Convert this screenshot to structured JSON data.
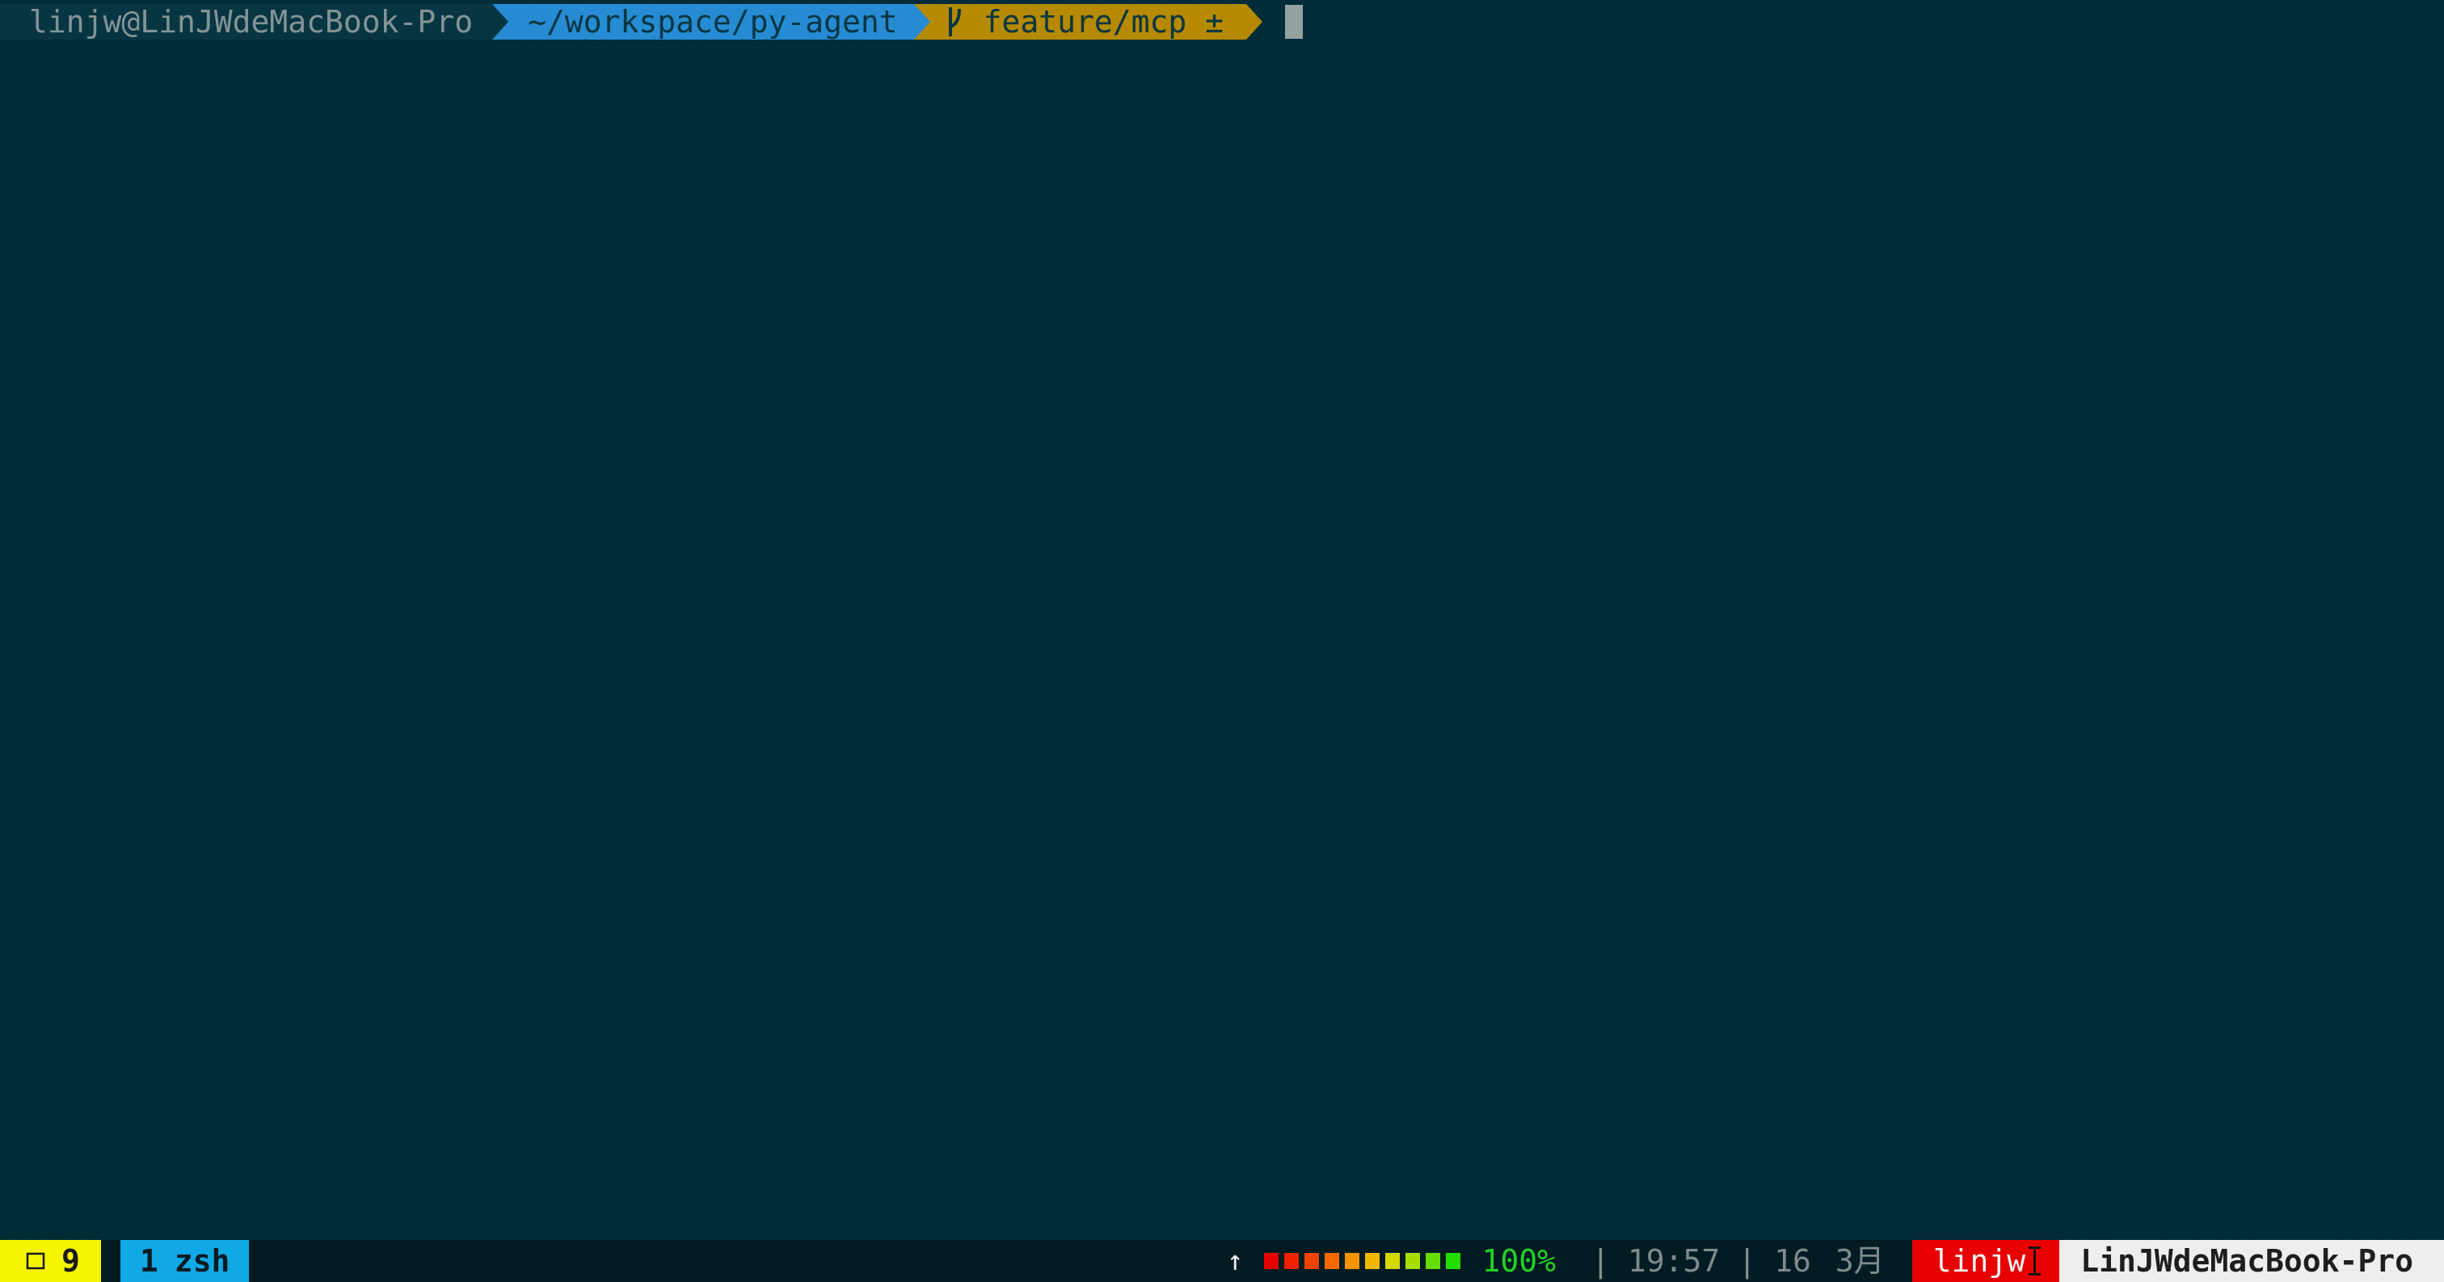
{
  "prompt": {
    "context": "linjw@LinJWdeMacBook-Pro",
    "directory": "~/workspace/py-agent",
    "branch_icon": "git-branch-icon",
    "branch": "feature/mcp ±"
  },
  "status_bar": {
    "session_icon": "window-icon",
    "session_count": "9",
    "window_index": "1",
    "window_name": "zsh",
    "upload_icon": "up-arrow-icon",
    "battery_level_bars": [
      "#e50000",
      "#ee2200",
      "#f24400",
      "#f56a00",
      "#f59400",
      "#f2b800",
      "#d6d600",
      "#a8dd00",
      "#66dd00",
      "#22dd00"
    ],
    "battery_percent": "100%",
    "time": "19:57",
    "day": "16",
    "month": "3月",
    "user": "linjw",
    "hostname": "LinJWdeMacBook-Pro"
  },
  "colors": {
    "background": "#002b36",
    "context_bg": "#073642",
    "directory_bg": "#268bd2",
    "git_bg": "#b58900",
    "session_bg": "#f5f500",
    "window_bg": "#10a9e6",
    "user_bg": "#e80000",
    "host_bg": "#eeeeee",
    "battery_text": "#25d025"
  }
}
